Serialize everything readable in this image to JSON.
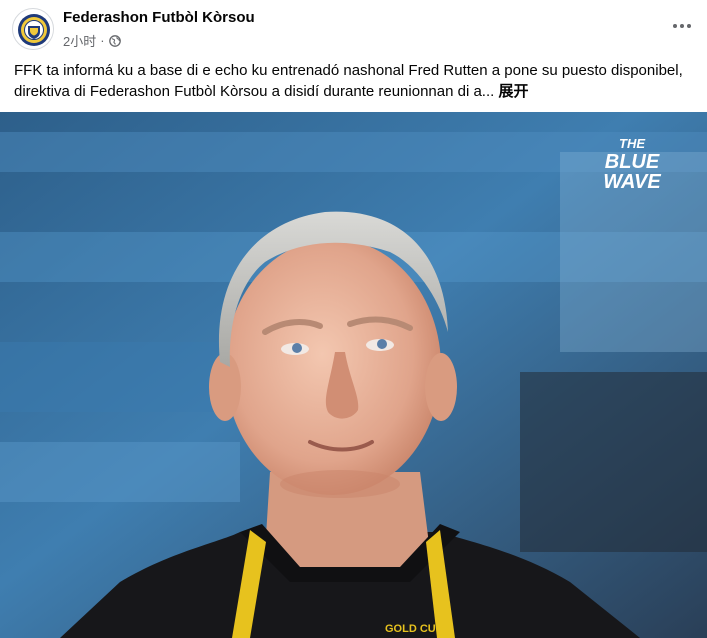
{
  "post": {
    "author": "Federashon Futbòl Kòrsou",
    "timestamp": "2小时",
    "dot": "·",
    "text_body": "FFK ta informá ku a base di e echo ku entrenadó nashonal Fred Rutten a pone su puesto disponibel, direktiva di Federashon Futbòl Kòrsou a disidí durante reunionnan di a...",
    "see_more": "展开",
    "privacy_icon": "globe-icon",
    "more_icon": "more-options-icon"
  },
  "photo": {
    "watermark_line1": "THE",
    "watermark_line2": "BLUE",
    "watermark_line3": "WAVE",
    "lanyard_text": "GOLD CUP",
    "colors": {
      "stadium_blue": "#3a6f99",
      "lanyard_yellow": "#e7c21e",
      "jacket_black": "#17171a"
    }
  }
}
